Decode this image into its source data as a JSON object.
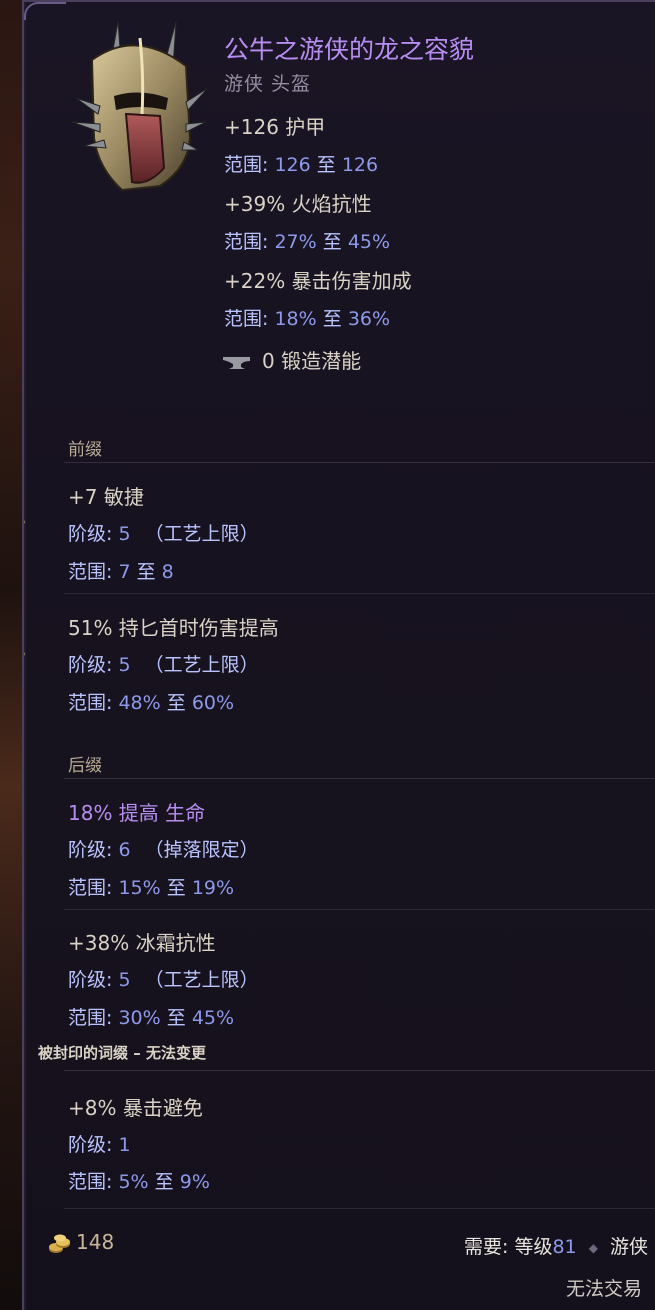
{
  "item": {
    "name": "公牛之游侠的龙之容貌",
    "type": "游侠 头盔",
    "implicits": [
      {
        "stat": "+126 护甲",
        "range_label": "范围",
        "range_min": "126",
        "range_to": "至",
        "range_max": "126"
      },
      {
        "stat": "+39% 火焰抗性",
        "range_label": "范围",
        "range_min": "27%",
        "range_to": "至",
        "range_max": "45%"
      },
      {
        "stat": "+22% 暴击伤害加成",
        "range_label": "范围",
        "range_min": "18%",
        "range_to": "至",
        "range_max": "36%"
      }
    ],
    "forge_potential": "0 锻造潜能"
  },
  "prefix_section": {
    "title": "前缀",
    "affixes": [
      {
        "name": "+7 敏捷",
        "tier_label": "阶级",
        "tier_value": "5",
        "tier_note": "（工艺上限）",
        "range_label": "范围",
        "range_min": "7",
        "range_to": "至",
        "range_max": "8"
      },
      {
        "name": "51% 持匕首时伤害提高",
        "tier_label": "阶级",
        "tier_value": "5",
        "tier_note": "（工艺上限）",
        "range_label": "范围",
        "range_min": "48%",
        "range_to": "至",
        "range_max": "60%"
      }
    ]
  },
  "suffix_section": {
    "title": "后缀",
    "affixes": [
      {
        "name": "18% 提高 生命",
        "tier_label": "阶级",
        "tier_value": "6",
        "tier_note": "（掉落限定）",
        "range_label": "范围",
        "range_min": "15%",
        "range_to": "至",
        "range_max": "19%"
      },
      {
        "name": "+38% 冰霜抗性",
        "tier_label": "阶级",
        "tier_value": "5",
        "tier_note": "（工艺上限）",
        "range_label": "范围",
        "range_min": "30%",
        "range_to": "至",
        "range_max": "45%"
      }
    ]
  },
  "sealed_section": {
    "title": "被封印的词缀 – 无法变更",
    "affix": {
      "name": "+8% 暴击避免",
      "tier_label": "阶级",
      "tier_value": "1",
      "range_label": "范围",
      "range_min": "5%",
      "range_to": "至",
      "range_max": "9%"
    }
  },
  "footer": {
    "gold_value": "148",
    "requirement_label": "需要:",
    "level_label": "等级",
    "level_value": "81",
    "class_name": "游侠",
    "trade_status": "无法交易"
  },
  "colors": {
    "title_purple": "#b88df2",
    "range_blue": "#8d99ea",
    "text_beige": "#d9d2c5",
    "panel_bg": "#17121f"
  },
  "icons": [
    "helmet-item-icon",
    "anvil-icon",
    "gold-coins-icon"
  ]
}
